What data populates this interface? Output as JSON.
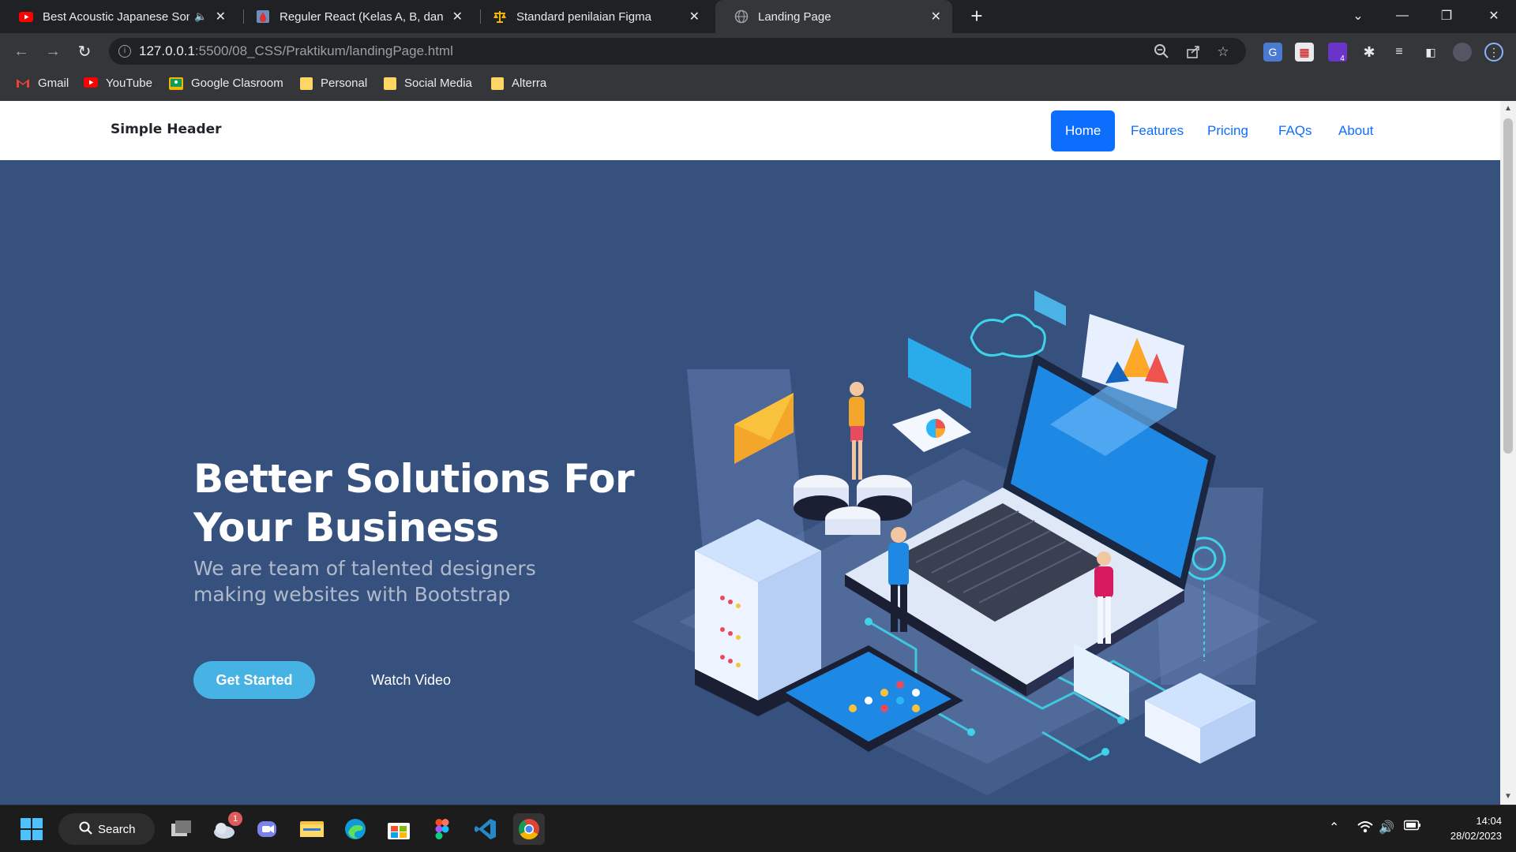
{
  "browser": {
    "tabs": [
      {
        "title": "Best Acoustic Japanese Song",
        "icon": "youtube-icon",
        "audio": true
      },
      {
        "title": "Reguler React (Kelas A, B, dan C)",
        "icon": "drop-icon"
      },
      {
        "title": "Standard penilaian Figma",
        "icon": "scale-icon"
      },
      {
        "title": "Landing Page",
        "icon": "globe-icon",
        "active": true
      }
    ],
    "new_tab": "+",
    "url_host": "127.0.0.1",
    "url_path": ":5500/08_CSS/Praktikum/landingPage.html",
    "extension_badge": "4",
    "bookmarks": [
      {
        "label": "Gmail",
        "icon": "gmail-icon"
      },
      {
        "label": "YouTube",
        "icon": "youtube-icon"
      },
      {
        "label": "Google Clasroom",
        "icon": "classroom-icon"
      },
      {
        "label": "Personal",
        "icon": "folder-icon"
      },
      {
        "label": "Social Media",
        "icon": "folder-icon"
      },
      {
        "label": "Alterra",
        "icon": "folder-icon"
      }
    ]
  },
  "page": {
    "brand": "Simple Header",
    "nav": [
      "Home",
      "Features",
      "Pricing",
      "FAQs",
      "About"
    ],
    "active_nav": "Home",
    "hero": {
      "title": "Better Solutions For Your Business",
      "subtitle": "We are team of talented designers making websites with Bootstrap",
      "primary_button": "Get Started",
      "secondary_button": "Watch Video"
    },
    "colors": {
      "hero_bg": "#37517e",
      "accent": "#47b2e4",
      "nav_active": "#0d6efd"
    }
  },
  "taskbar": {
    "search_label": "Search",
    "notification_badge": "1",
    "time": "14:04",
    "date": "28/02/2023"
  }
}
